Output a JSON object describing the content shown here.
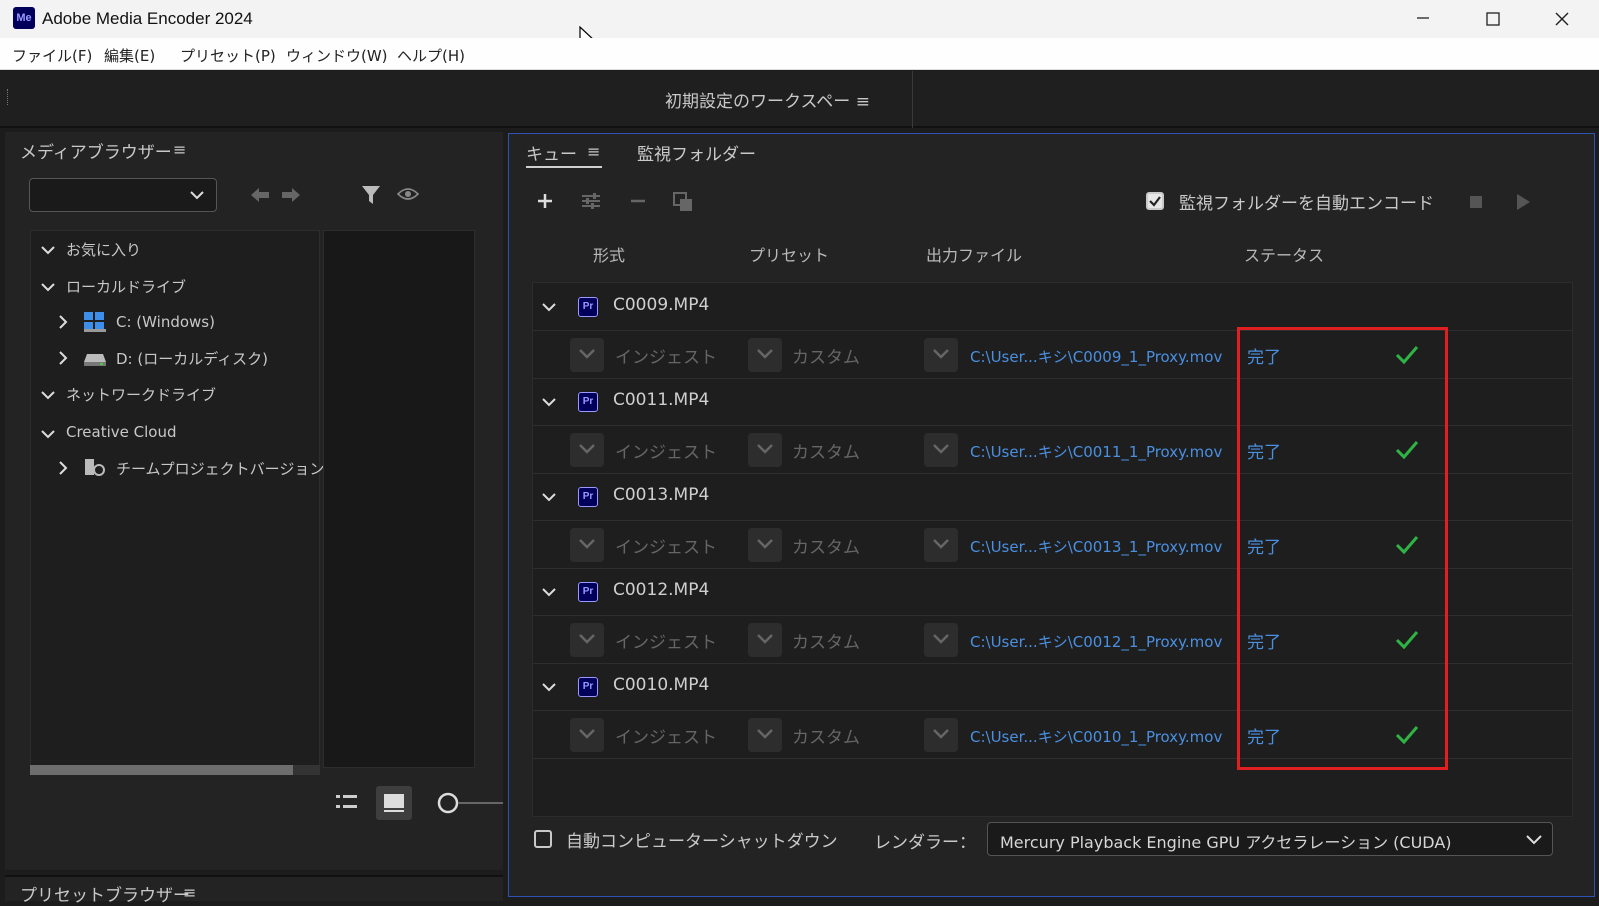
{
  "window": {
    "app_icon": "Me",
    "title": "Adobe Media Encoder 2024",
    "controls": {
      "minimize": "minimize-icon",
      "maximize": "maximize-icon",
      "close": "close-icon"
    }
  },
  "menu": [
    "ファイル(F)",
    "編集(E)",
    "プリセット(P)",
    "ウィンドウ(W)",
    "ヘルプ(H)"
  ],
  "workspace": {
    "title": "初期設定のワークスペー ≡"
  },
  "media_browser": {
    "title": "メディアブラウザー",
    "menu_icon": "≡",
    "tree": [
      {
        "label": "お気に入り",
        "expanded": true
      },
      {
        "label": "ローカルドライブ",
        "expanded": true
      },
      {
        "label": "C: (Windows)",
        "expanded": false
      },
      {
        "label": "D: (ローカルディスク)",
        "expanded": false
      },
      {
        "label": "ネットワークドライブ",
        "expanded": true
      },
      {
        "label": "Creative Cloud",
        "expanded": true
      },
      {
        "label": "チームプロジェクトバージョン",
        "expanded": false
      }
    ]
  },
  "preset_browser": {
    "title": "プリセットブラウザー",
    "menu_icon": "≡"
  },
  "queue_panel": {
    "tabs": [
      "キュー",
      "監視フォルダー"
    ],
    "menu_icon": "≡",
    "auto_encode_label": "監視フォルダーを自動エンコード",
    "auto_encode_checked": true,
    "columns": [
      "形式",
      "プリセット",
      "出力ファイル",
      "ステータス"
    ],
    "items": [
      {
        "source": "C0009.MP4",
        "badge": "Pr",
        "format": "インジェスト",
        "preset": "カスタム",
        "output": "C:\\User...キシ\\C0009_1_Proxy.mov",
        "status": "完了"
      },
      {
        "source": "C0011.MP4",
        "badge": "Pr",
        "format": "インジェスト",
        "preset": "カスタム",
        "output": "C:\\User...キシ\\C0011_1_Proxy.mov",
        "status": "完了"
      },
      {
        "source": "C0013.MP4",
        "badge": "Pr",
        "format": "インジェスト",
        "preset": "カスタム",
        "output": "C:\\User...キシ\\C0013_1_Proxy.mov",
        "status": "完了"
      },
      {
        "source": "C0012.MP4",
        "badge": "Pr",
        "format": "インジェスト",
        "preset": "カスタム",
        "output": "C:\\User...キシ\\C0012_1_Proxy.mov",
        "status": "完了"
      },
      {
        "source": "C0010.MP4",
        "badge": "Pr",
        "format": "インジェスト",
        "preset": "カスタム",
        "output": "C:\\User...キシ\\C0010_1_Proxy.mov",
        "status": "完了"
      }
    ],
    "shutdown_label": "自動コンピューターシャットダウン",
    "shutdown_checked": false,
    "renderer_label": "レンダラー：",
    "renderer_value": "Mercury Playback Engine GPU アクセラレーション (CUDA)"
  },
  "colors": {
    "accent": "#4a8fe0",
    "success": "#2fb344",
    "highlight": "#e02020",
    "panel_border": "#2f52b5"
  }
}
